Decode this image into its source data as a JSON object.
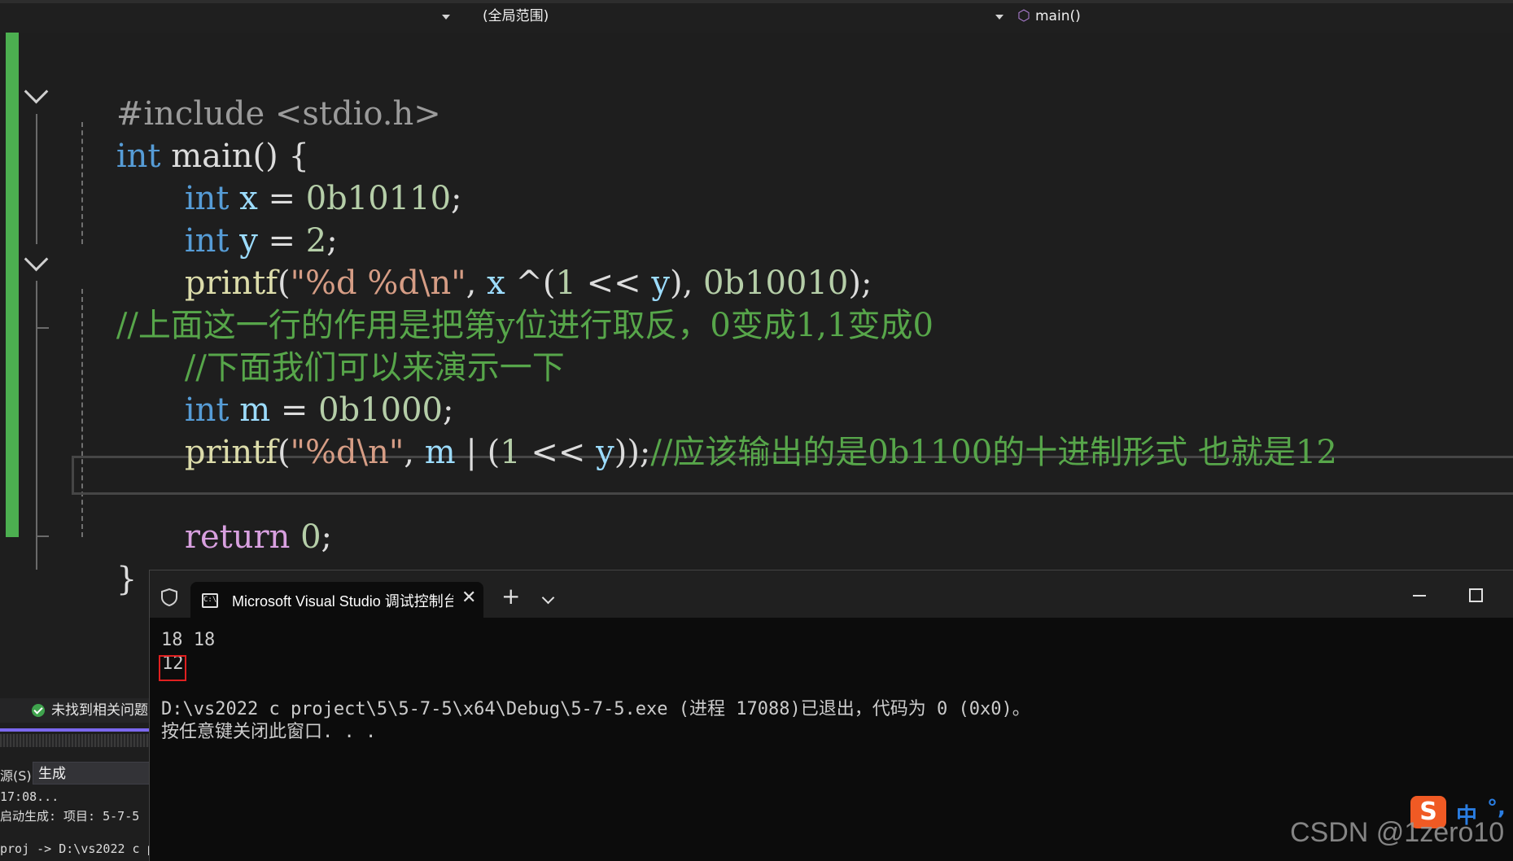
{
  "navbar": {
    "scope_label": "(全局范围)",
    "function_label": "main()"
  },
  "code": {
    "line1": {
      "pp": "#include <stdio.h>"
    },
    "line2": {
      "kw": "int",
      "rest": " main() {"
    },
    "line3": {
      "kw": "int",
      "var": "x",
      "eq": " = ",
      "num": "0b10110",
      "end": ";"
    },
    "line4": {
      "kw": "int",
      "var": "y",
      "eq": " = ",
      "num": "2",
      "end": ";"
    },
    "line5": {
      "fn": "printf",
      "p1": "(",
      "str": "\"%d %d\\n\"",
      "p2": ", ",
      "v1": "x",
      "op1": " ^(",
      "n1": "1",
      "op2": " << ",
      "v2": "y",
      "p3": "), ",
      "n2": "0b10010",
      "end": ");"
    },
    "line6": {
      "cm": "//上面这一行的作用是把第y位进行取反，0变成1,1变成0"
    },
    "line7": {
      "cm": "//下面我们可以来演示一下"
    },
    "line8": {
      "kw": "int",
      "var": "m",
      "eq": " = ",
      "num": "0b1000",
      "end": ";"
    },
    "line9": {
      "fn": "printf",
      "p1": "(",
      "str": "\"%d\\n\"",
      "p2": ", ",
      "v1": "m",
      "op1": " | (",
      "n1": "1",
      "op2": " << ",
      "v2": "y",
      "p3": "));",
      "cm": "//应该输出的是0b1100的十进制形式 也就是12"
    },
    "line11": {
      "kw": "return",
      "num": " 0",
      "end": ";"
    },
    "line12": {
      "brace": "}"
    }
  },
  "status": {
    "issues_text": "未找到相关问题"
  },
  "output_panel": {
    "source_label": "源(S):",
    "source_value": "生成",
    "line1": "17:08...",
    "line2": "启动生成: 项目: 5-7-5",
    "line3": "proj -> D:\\vs2022 c p"
  },
  "terminal": {
    "tab_icon_text": "C:\\",
    "tab_title": "Microsoft Visual Studio 调试控制台",
    "close_glyph": "✕",
    "new_tab_glyph": "+",
    "output_lines": [
      "18 18",
      "12",
      "",
      "D:\\vs2022 c project\\5\\5-7-5\\x64\\Debug\\5-7-5.exe (进程 17088)已退出，代码为 0 (0x0)。",
      "按任意键关闭此窗口. . ."
    ]
  },
  "ime": {
    "logo": "S",
    "mode": "中",
    "punct": "°,"
  },
  "watermark": "CSDN @1zero10"
}
